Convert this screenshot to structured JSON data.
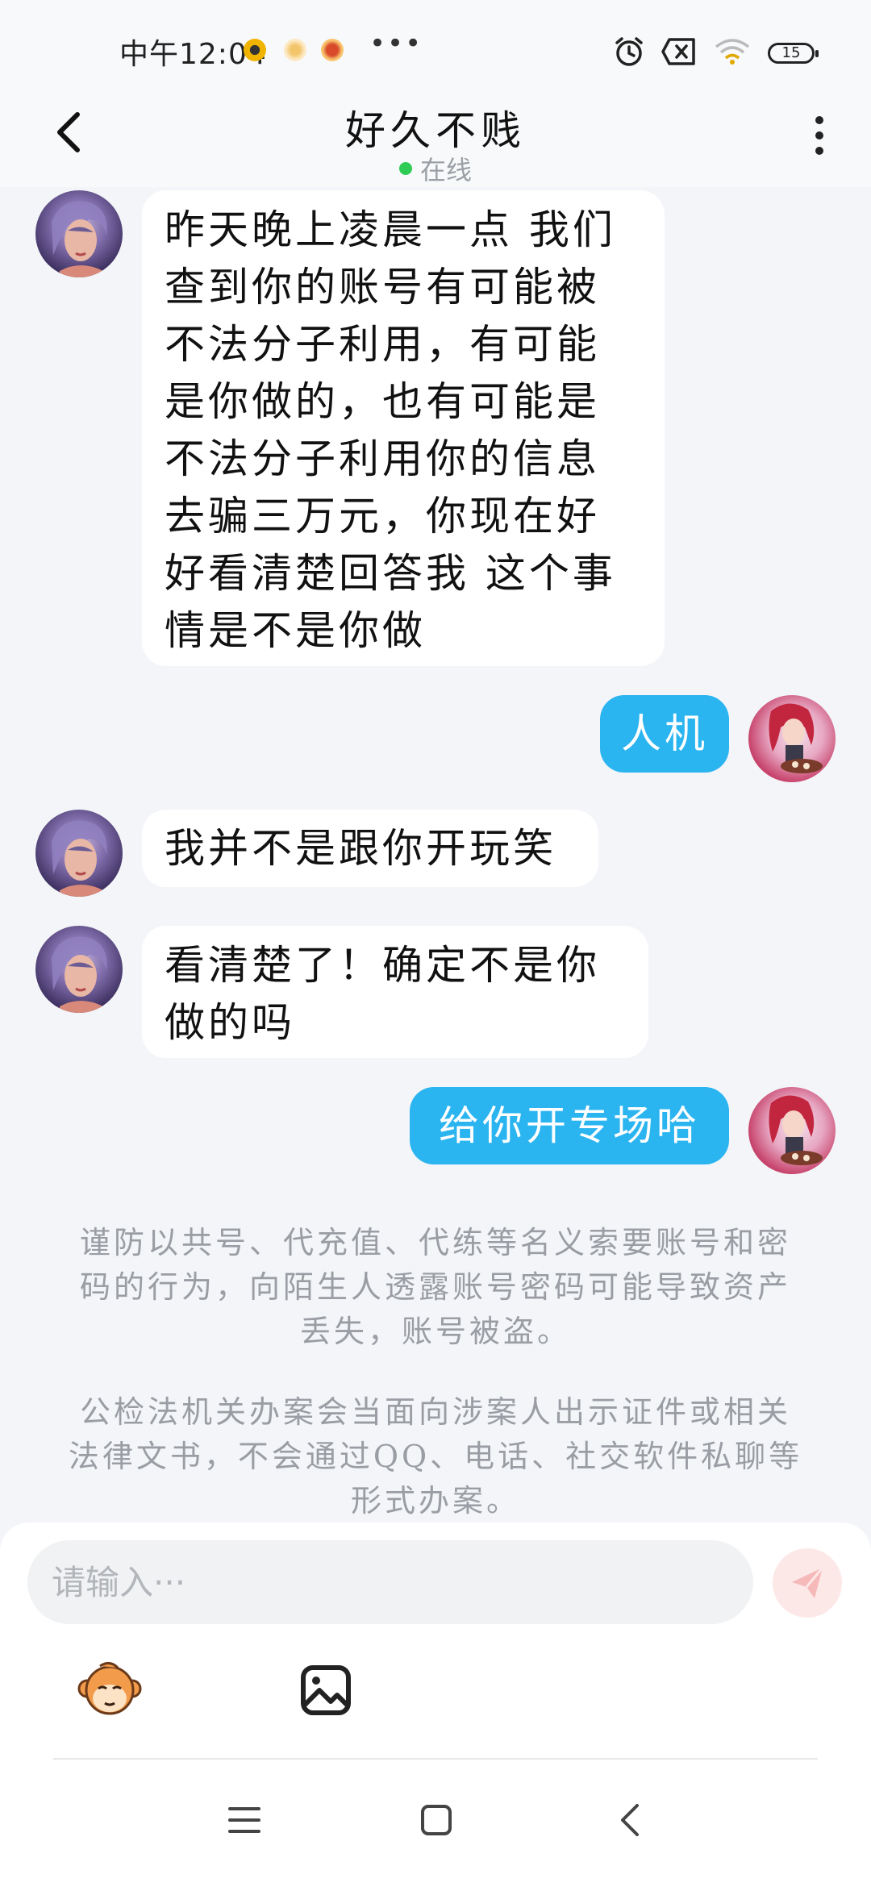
{
  "status_bar": {
    "time": "中午12:04",
    "dots": "•••",
    "battery": "15"
  },
  "header": {
    "title": "好久不贱",
    "status": "在线"
  },
  "messages": [
    {
      "sender": "other",
      "text": "昨天晚上凌晨一点 我们查到你的账号有可能被不法分子利用，有可能是你做的，也有可能是不法分子利用你的信息去骗三万元，你现在好好看清楚回答我 这个事情是不是你做"
    },
    {
      "sender": "self",
      "text": "人机"
    },
    {
      "sender": "other",
      "text": "我并不是跟你开玩笑"
    },
    {
      "sender": "other",
      "text": "看清楚了！确定不是你做的吗"
    },
    {
      "sender": "self",
      "text": "给你开专场哈"
    }
  ],
  "notices": [
    "谨防以共号、代充值、代练等名义索要账号和密码的行为，向陌生人透露账号密码可能导致资产丢失，账号被盗。",
    "公检法机关办案会当面向涉案人出示证件或相关法律文书，不会通过QQ、电话、社交软件私聊等形式办案。"
  ],
  "input": {
    "placeholder": "请输入···",
    "value": ""
  },
  "colors": {
    "accent": "#2ab4f0",
    "background": "#f3f5f8",
    "online": "#2ecc55"
  }
}
